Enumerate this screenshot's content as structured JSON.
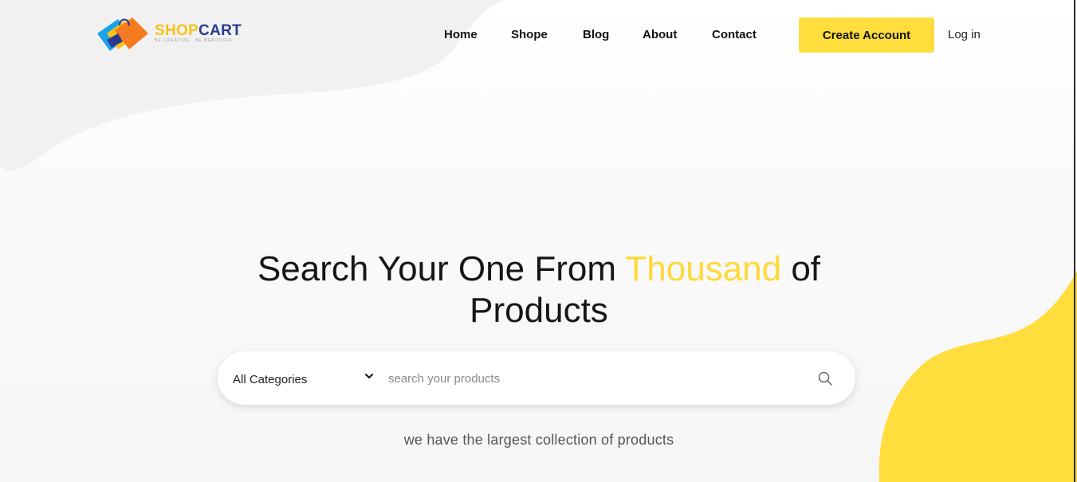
{
  "brand": {
    "name_part1": "SHOP",
    "name_part2": "CART",
    "tagline": "BE CREATIVE · BE BEAUTIFUL",
    "colors": {
      "yellow": "#f7c21a",
      "navy": "#2a3b8f",
      "orange": "#f47b20",
      "blue": "#1aa3e8"
    }
  },
  "nav": {
    "items": [
      {
        "label": "Home"
      },
      {
        "label": "Shope"
      },
      {
        "label": "Blog"
      },
      {
        "label": "About"
      },
      {
        "label": "Contact"
      }
    ]
  },
  "header": {
    "create_account_label": "Create Account",
    "login_label": "Log in"
  },
  "hero": {
    "title_part1": "Search Your One From ",
    "title_accent": "Thousand",
    "title_part2": " of Products",
    "subtitle": "we have the largest collection of products"
  },
  "search": {
    "category_selected": "All Categories",
    "placeholder": "search your products",
    "value": ""
  },
  "icons": {
    "category": "chevron-down-icon",
    "search": "search-icon"
  },
  "theme": {
    "accent": "#ffdd3c",
    "blob_yellow": "#ffdd3c",
    "blob_gray": "#f0f0f0"
  }
}
